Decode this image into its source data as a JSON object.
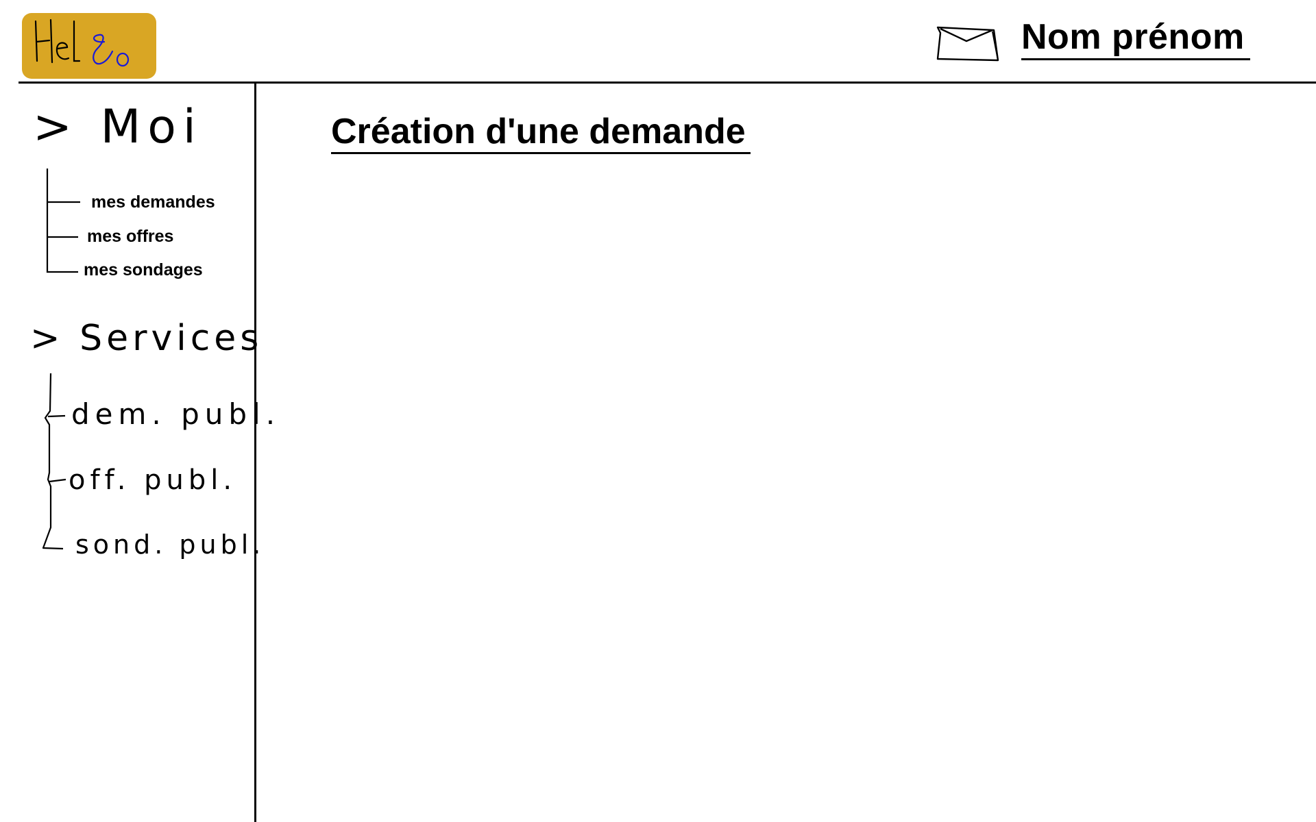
{
  "header": {
    "logo_text": "Hel&o",
    "user_name": "Nom prénom",
    "mail_icon": "envelope-icon"
  },
  "sidebar": {
    "sections": [
      {
        "label": "> Moi",
        "items": [
          {
            "label": "mes demandes"
          },
          {
            "label": "mes offres"
          },
          {
            "label": "mes sondages"
          }
        ]
      },
      {
        "label": "> Services",
        "items": [
          {
            "label": "dem. publ."
          },
          {
            "label": "off. publ."
          },
          {
            "label": "sond. publ."
          }
        ]
      }
    ]
  },
  "main": {
    "title": "Création d'une demande"
  },
  "colors": {
    "logo_background": "#d9a624",
    "logo_accent": "#1a1ad6",
    "ink": "#000000",
    "background": "#ffffff"
  }
}
